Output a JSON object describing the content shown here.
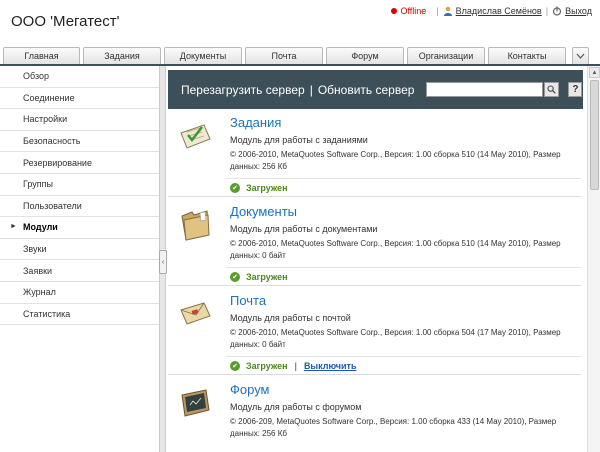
{
  "app": {
    "title": "ООО 'Мегатест'"
  },
  "topbar": {
    "status": "Offline",
    "user": "Владислав Семёнов",
    "logout": "Выход"
  },
  "tabs": [
    "Главная",
    "Задания",
    "Документы",
    "Почта",
    "Форум",
    "Организации",
    "Контакты"
  ],
  "sidebar": {
    "items": [
      "Обзор",
      "Соединение",
      "Настройки",
      "Безопасность",
      "Резервирование",
      "Группы",
      "Пользователи",
      "Модули",
      "Звуки",
      "Заявки",
      "Журнал",
      "Статистика"
    ],
    "active": "Модули"
  },
  "toolbar": {
    "restart": "Перезагрузить сервер",
    "separator": "|",
    "update": "Обновить сервер",
    "search_value": "",
    "help": "?"
  },
  "modules": [
    {
      "title": "Задания",
      "description": "Модуль для работы с заданиями",
      "info": "© 2006-2010, MetaQuotes Software Corp., Версия: 1.00 сборка 510 (14 May 2010), Размер данных: 256 Кб",
      "status": "Загружен",
      "icon": "tasks-icon"
    },
    {
      "title": "Документы",
      "description": "Модуль для работы с документами",
      "info": "© 2006-2010, MetaQuotes Software Corp., Версия: 1.00 сборка 510 (14 May 2010), Размер данных: 0 байт",
      "status": "Загружен",
      "icon": "folder-icon"
    },
    {
      "title": "Почта",
      "description": "Модуль для работы с почтой",
      "info": "© 2006-2010, MetaQuotes Software Corp., Версия: 1.00 сборка 504 (17 May 2010), Размер данных: 0 байт",
      "status": "Загружен",
      "action": "Выключить",
      "icon": "mail-icon"
    },
    {
      "title": "Форум",
      "description": "Модуль для работы с форумом",
      "info": "© 2006-209, MetaQuotes Software Corp., Версия: 1.00 сборка 433 (14 May 2010), Размер данных: 256 Кб",
      "status": "",
      "icon": "forum-icon"
    }
  ],
  "colors": {
    "toolbar": "#3d5059",
    "link": "#1a73c2",
    "ok": "#5a9c2a",
    "offline": "#cc0000"
  }
}
